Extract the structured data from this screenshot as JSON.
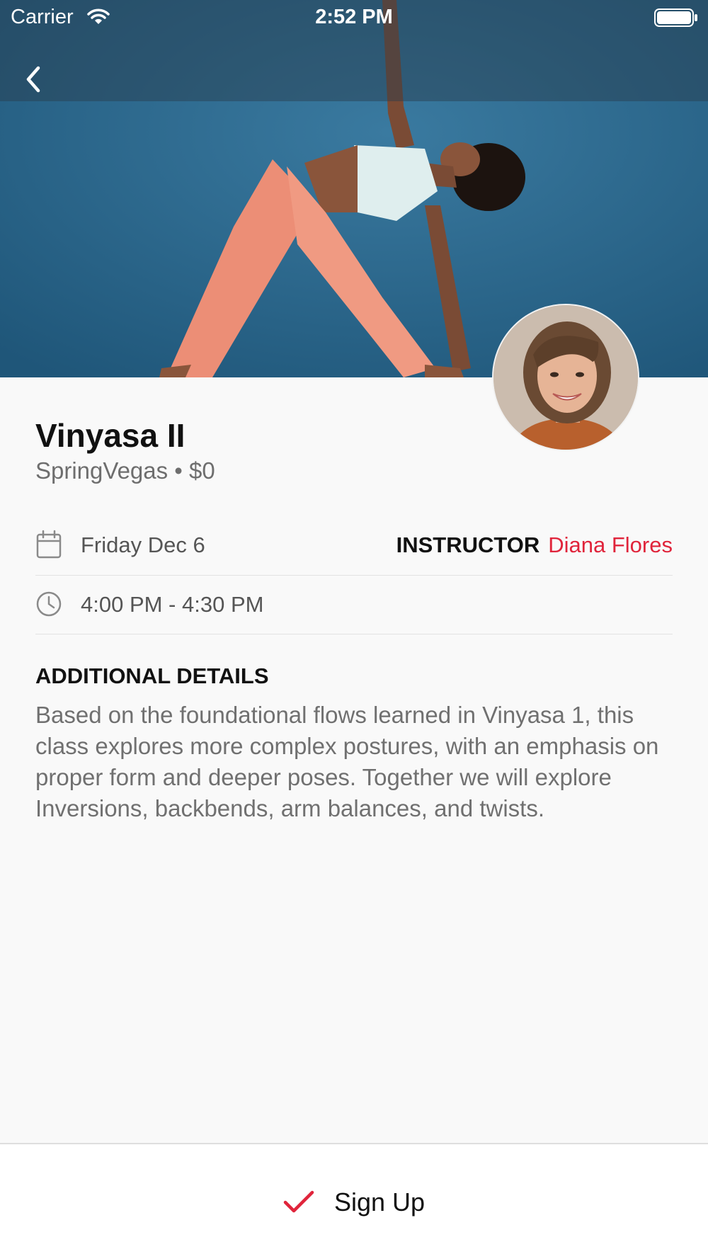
{
  "status_bar": {
    "carrier": "Carrier",
    "time": "2:52 PM"
  },
  "class": {
    "title": "Vinyasa II",
    "subtitle": "SpringVegas • $0",
    "date": "Friday Dec 6",
    "time_range": "4:00 PM - 4:30 PM",
    "instructor_label": "INSTRUCTOR",
    "instructor_name": "Diana Flores"
  },
  "details": {
    "heading": "ADDITIONAL DETAILS",
    "body": "Based on the foundational flows learned in Vinyasa 1, this class explores more complex postures, with an emphasis on proper form and deeper poses. Together we will explore Inversions, backbends, arm balances, and twists."
  },
  "actions": {
    "signup_label": "Sign Up"
  },
  "icons": {
    "back": "chevron-left-icon",
    "calendar": "calendar-icon",
    "clock": "clock-icon",
    "signup": "checkmark-icon",
    "wifi": "wifi-icon",
    "battery": "battery-icon"
  },
  "colors": {
    "accent": "#e0243b",
    "hero_background": "#245e83",
    "page_background": "#f9f9f9"
  }
}
